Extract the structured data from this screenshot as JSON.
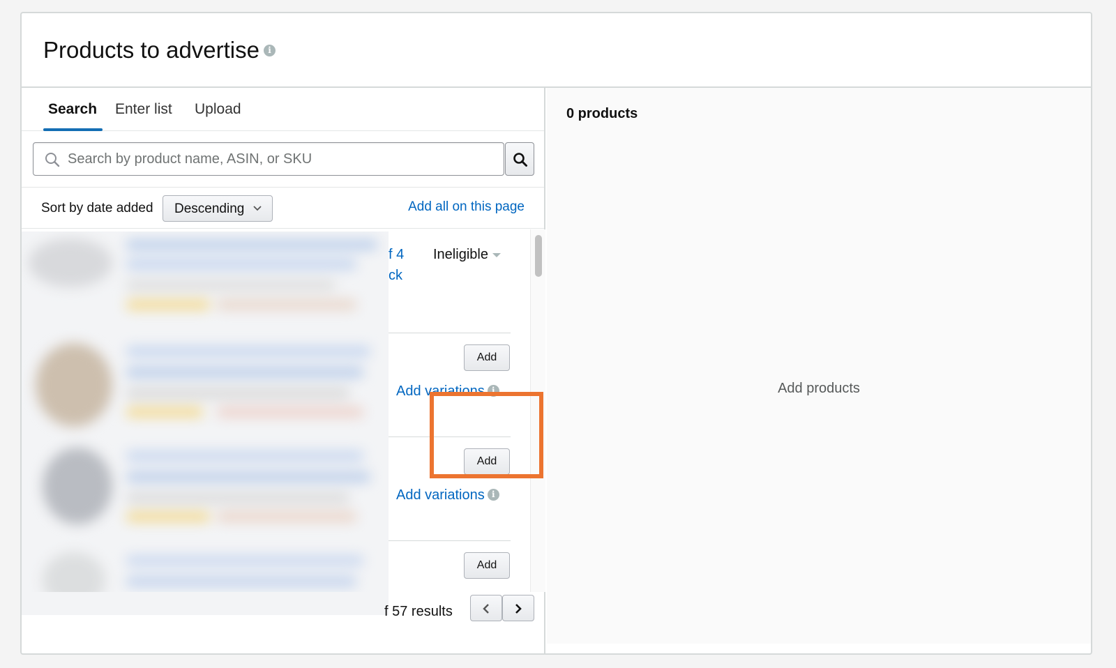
{
  "header": {
    "title": "Products to advertise",
    "info_icon": "info-icon"
  },
  "tabs": [
    {
      "label": "Search",
      "active": true
    },
    {
      "label": "Enter list",
      "active": false
    },
    {
      "label": "Upload",
      "active": false
    }
  ],
  "search": {
    "placeholder": "Search by product name, ASIN, or SKU",
    "value": ""
  },
  "sort": {
    "label": "Sort by date added",
    "selected": "Descending",
    "add_all_label": "Add all on this page"
  },
  "rows": [
    {
      "partial_text_1": "f 4",
      "partial_text_2": "ck",
      "status": "Ineligible"
    },
    {
      "add_label": "Add",
      "variations_label": "Add variations"
    },
    {
      "add_label": "Add",
      "variations_label": "Add variations"
    },
    {
      "add_label": "Add"
    }
  ],
  "pager": {
    "results_text": "f 57 results"
  },
  "selected_panel": {
    "count_label": "0 products",
    "empty_message": "Add products"
  },
  "colors": {
    "link": "#0066c0",
    "tab_underline": "#146eb4",
    "highlight": "#ec7430"
  }
}
